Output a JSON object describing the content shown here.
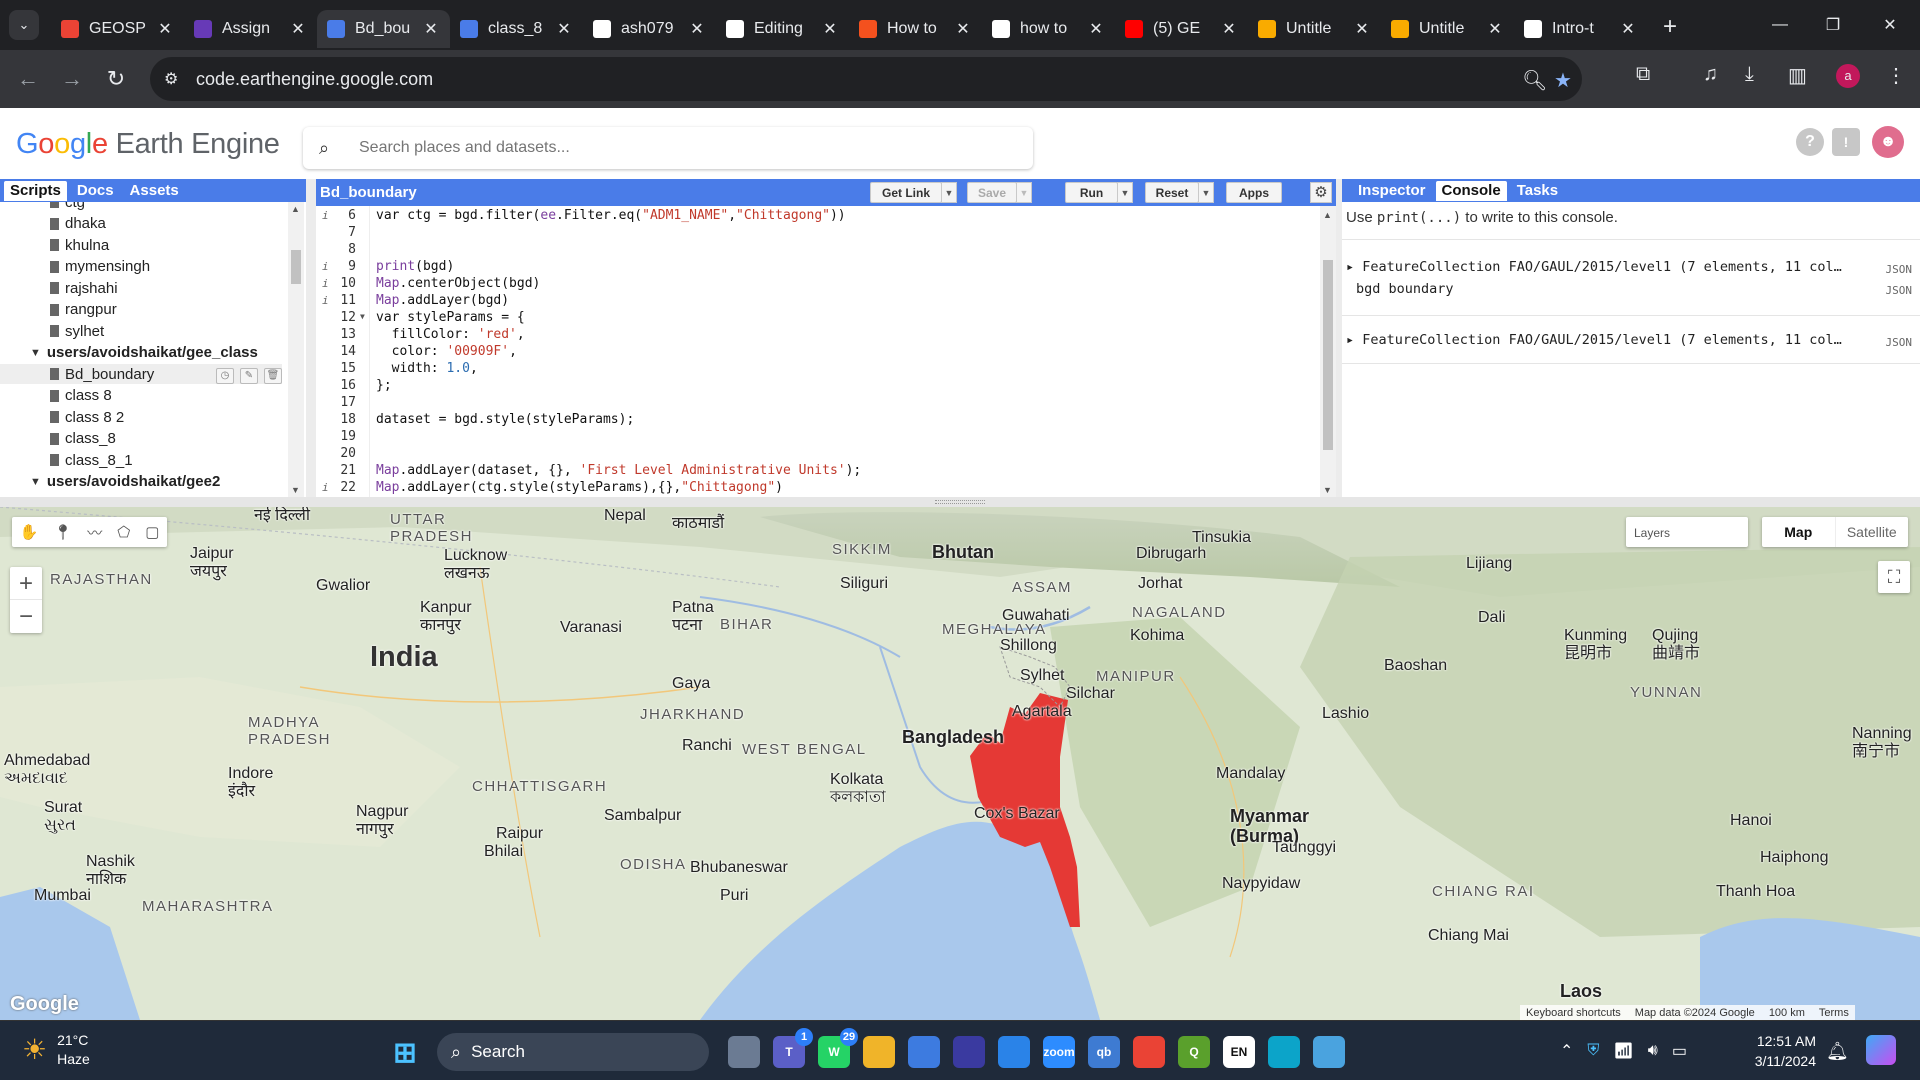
{
  "browser": {
    "tabs": [
      {
        "title": "GEOSP",
        "icon": "gmail-icon",
        "color": "#ea4335",
        "active": false
      },
      {
        "title": "Assign",
        "icon": "forms-icon",
        "color": "#673ab7",
        "active": false
      },
      {
        "title": "Bd_bou",
        "icon": "earth-engine-icon",
        "color": "#4a7ce8",
        "active": true
      },
      {
        "title": "class_8",
        "icon": "earth-engine-icon",
        "color": "#4a7ce8",
        "active": false
      },
      {
        "title": "ash079",
        "icon": "github-icon",
        "color": "#ffffff",
        "active": false
      },
      {
        "title": "Editing",
        "icon": "github-icon",
        "color": "#ffffff",
        "active": false
      },
      {
        "title": "How to",
        "icon": "page-icon",
        "color": "#f4511e",
        "active": false
      },
      {
        "title": "how to",
        "icon": "google-icon",
        "color": "#ffffff",
        "active": false
      },
      {
        "title": "(5) GE",
        "icon": "youtube-icon",
        "color": "#ff0000",
        "active": false
      },
      {
        "title": "Untitle",
        "icon": "colab-icon",
        "color": "#f9ab00",
        "active": false
      },
      {
        "title": "Untitle",
        "icon": "colab-icon",
        "color": "#f9ab00",
        "active": false
      },
      {
        "title": "Intro-t",
        "icon": "github-icon",
        "color": "#ffffff",
        "active": false
      }
    ],
    "url": "code.earthengine.google.com",
    "profile_letter": "a"
  },
  "gee": {
    "logo_google": "Google",
    "logo_rest": "Earth Engine",
    "search_placeholder": "Search places and datasets...",
    "left_tabs": [
      "Scripts",
      "Docs",
      "Assets"
    ],
    "tree": [
      {
        "label": "ctg",
        "type": "file",
        "indent": 1
      },
      {
        "label": "dhaka",
        "type": "file",
        "indent": 1
      },
      {
        "label": "khulna",
        "type": "file",
        "indent": 1
      },
      {
        "label": "mymensingh",
        "type": "file",
        "indent": 1
      },
      {
        "label": "rajshahi",
        "type": "file",
        "indent": 1
      },
      {
        "label": "rangpur",
        "type": "file",
        "indent": 1
      },
      {
        "label": "sylhet",
        "type": "file",
        "indent": 1
      },
      {
        "label": "users/avoidshaikat/gee_class",
        "type": "folder",
        "indent": 0
      },
      {
        "label": "Bd_boundary",
        "type": "file",
        "indent": 1,
        "selected": true
      },
      {
        "label": "class 8",
        "type": "file",
        "indent": 1
      },
      {
        "label": "class 8 2",
        "type": "file",
        "indent": 1
      },
      {
        "label": "class_8",
        "type": "file",
        "indent": 1
      },
      {
        "label": "class_8_1",
        "type": "file",
        "indent": 1
      },
      {
        "label": "users/avoidshaikat/gee2",
        "type": "folder",
        "indent": 0
      }
    ],
    "editor": {
      "title": "Bd_boundary",
      "buttons": {
        "get_link": "Get Link",
        "save": "Save",
        "run": "Run",
        "reset": "Reset",
        "apps": "Apps"
      },
      "lines": [
        {
          "n": "6",
          "info": true,
          "fold": false,
          "code": "var ctg = bgd.filter(ee.Filter.eq(\"ADM1_NAME\",\"Chittagong\"))"
        },
        {
          "n": "7",
          "info": false,
          "fold": false,
          "code": ""
        },
        {
          "n": "8",
          "info": false,
          "fold": false,
          "code": ""
        },
        {
          "n": "9",
          "info": true,
          "fold": false,
          "code": "print(bgd)"
        },
        {
          "n": "10",
          "info": true,
          "fold": false,
          "code": "Map.centerObject(bgd)"
        },
        {
          "n": "11",
          "info": true,
          "fold": false,
          "code": "Map.addLayer(bgd)"
        },
        {
          "n": "12",
          "info": false,
          "fold": true,
          "code": "var styleParams = {"
        },
        {
          "n": "13",
          "info": false,
          "fold": false,
          "code": "  fillColor: 'red',"
        },
        {
          "n": "14",
          "info": false,
          "fold": false,
          "code": "  color: '00909F',"
        },
        {
          "n": "15",
          "info": false,
          "fold": false,
          "code": "  width: 1.0,"
        },
        {
          "n": "16",
          "info": false,
          "fold": false,
          "code": "};"
        },
        {
          "n": "17",
          "info": false,
          "fold": false,
          "code": ""
        },
        {
          "n": "18",
          "info": false,
          "fold": false,
          "code": "dataset = bgd.style(styleParams);"
        },
        {
          "n": "19",
          "info": false,
          "fold": false,
          "code": ""
        },
        {
          "n": "20",
          "info": false,
          "fold": false,
          "code": ""
        },
        {
          "n": "21",
          "info": false,
          "fold": false,
          "code": "Map.addLayer(dataset, {}, 'First Level Administrative Units');"
        },
        {
          "n": "22",
          "info": true,
          "fold": false,
          "code": "Map.addLayer(ctg.style(styleParams),{},\"Chittagong\")"
        }
      ]
    },
    "right_tabs": [
      "Inspector",
      "Console",
      "Tasks"
    ],
    "console": {
      "hint_pre": "Use ",
      "hint_code": "print(...)",
      "hint_post": " to write to this console.",
      "entries": [
        {
          "text": "FeatureCollection FAO/GAUL/2015/level1 (7 elements, 11 col…",
          "tag": "JSON",
          "sub": "bgd boundary",
          "sub_tag": "JSON"
        },
        {
          "text": "FeatureCollection FAO/GAUL/2015/level1 (7 elements, 11 col…",
          "tag": "JSON"
        }
      ]
    }
  },
  "map": {
    "layers_label": "Layers",
    "type_map": "Map",
    "type_satellite": "Satellite",
    "zoom_in": "+",
    "zoom_out": "−",
    "attribution": [
      "Keyboard shortcuts",
      "Map data ©2024 Google",
      "100 km",
      "Terms"
    ],
    "google_logo": "Google",
    "labels": {
      "india": "India",
      "bangladesh": "Bangladesh",
      "bhutan": "Bhutan",
      "myanmar": "Myanmar\n(Burma)",
      "laos": "Laos",
      "rajasthan": "RAJASTHAN",
      "uttar_pradesh": "UTTAR\nPRADESH",
      "madhya_pradesh": "MADHYA\nPRADESH",
      "bihar": "BIHAR",
      "jharkhand": "JHARKHAND",
      "west_bengal": "WEST BENGAL",
      "chhattisgarh": "CHHATTISGARH",
      "odisha": "ODISHA",
      "maharashtra": "MAHARASHTRA",
      "sikkim": "SIKKIM",
      "assam": "ASSAM",
      "nagaland": "NAGALAND",
      "manipur": "MANIPUR",
      "meghalaya": "MEGHALAYA",
      "yunnan": "YUNNAN",
      "chiang_rai": "CHIANG RAI",
      "new_delhi": "नई दिल्ली",
      "jaipur": "Jaipur\nजयपुर",
      "lucknow": "Lucknow\nलखनऊ",
      "kanpur": "Kanpur\nकानपुर",
      "patna": "Patna\nपटना",
      "kolkata": "Kolkata\nকলকাতা",
      "ahmedabad": "Ahmedabad\nઅમદાવાદ",
      "indore": "Indore\nइंदौर",
      "nagpur": "Nagpur\nनागपुर",
      "surat": "Surat\nસુરત",
      "nashik": "Nashik\nनाशिक",
      "mumbai": "Mumbai",
      "mandalay": "Mandalay",
      "kunming": "Kunming\n昆明市",
      "hanoi": "Hanoi",
      "haiphong": "Haiphong",
      "guwahati": "Guwahati",
      "sylhet": "Sylhet",
      "agartala": "Agartala",
      "coxs_bazar": "Cox's Bazar",
      "nepal": "Nepal",
      "kathmandu": "काठमाडौं",
      "gwalior": "Gwalior",
      "varanasi": "Varanasi",
      "gaya": "Gaya",
      "ranchi": "Ranchi",
      "siliguri": "Siliguri",
      "dibrugarh": "Dibrugarh",
      "jorhat": "Jorhat",
      "kohima": "Kohima",
      "silchar": "Silchar",
      "shillong": "Shillong",
      "puri": "Puri",
      "raipur": "Raipur",
      "bhilai": "Bhilai",
      "sambalpur": "Sambalpur",
      "bhubaneswar": "Bhubaneswar",
      "lashio": "Lashio",
      "taunggyi": "Taunggyi",
      "naypyidaw": "Naypyidaw",
      "chiang_mai": "Chiang Mai",
      "thanh_hoa": "Thanh Hoa",
      "nanning": "Nanning\n南宁市",
      "qujing": "Qujing\n曲靖市",
      "dali": "Dali",
      "baoshan": "Baoshan",
      "lijiang": "Lijiang",
      "tinsukia": "Tinsukia"
    }
  },
  "taskbar": {
    "temp": "21°C",
    "weather": "Haze",
    "search": "Search",
    "apps": [
      {
        "name": "task-view-icon",
        "label": "",
        "color": "#6b7b93"
      },
      {
        "name": "teams-icon",
        "label": "T",
        "color": "#5b5fc7",
        "badge": "1"
      },
      {
        "name": "whatsapp-icon",
        "label": "W",
        "color": "#25d366",
        "badge": "29"
      },
      {
        "name": "file-explorer-icon",
        "label": "",
        "color": "#f0b429"
      },
      {
        "name": "store-icon",
        "label": "",
        "color": "#3d7be0"
      },
      {
        "name": "app-icon",
        "label": "",
        "color": "#3a3aa0"
      },
      {
        "name": "mail-icon",
        "label": "",
        "color": "#2a83e8"
      },
      {
        "name": "zoom-icon",
        "label": "zoom",
        "color": "#2d8cff"
      },
      {
        "name": "qbittorrent-icon",
        "label": "qb",
        "color": "#3e7bd2"
      },
      {
        "name": "chrome-icon",
        "label": "",
        "color": "#ea4335"
      },
      {
        "name": "qgis-icon",
        "label": "Q",
        "color": "#5aa02c"
      },
      {
        "name": "language-icon",
        "label": "EN",
        "color": "#ffffff"
      },
      {
        "name": "edge-icon",
        "label": "",
        "color": "#0ca4c9"
      },
      {
        "name": "paint-icon",
        "label": "",
        "color": "#4aa3df"
      }
    ],
    "time": "12:51 AM",
    "date": "3/11/2024"
  }
}
